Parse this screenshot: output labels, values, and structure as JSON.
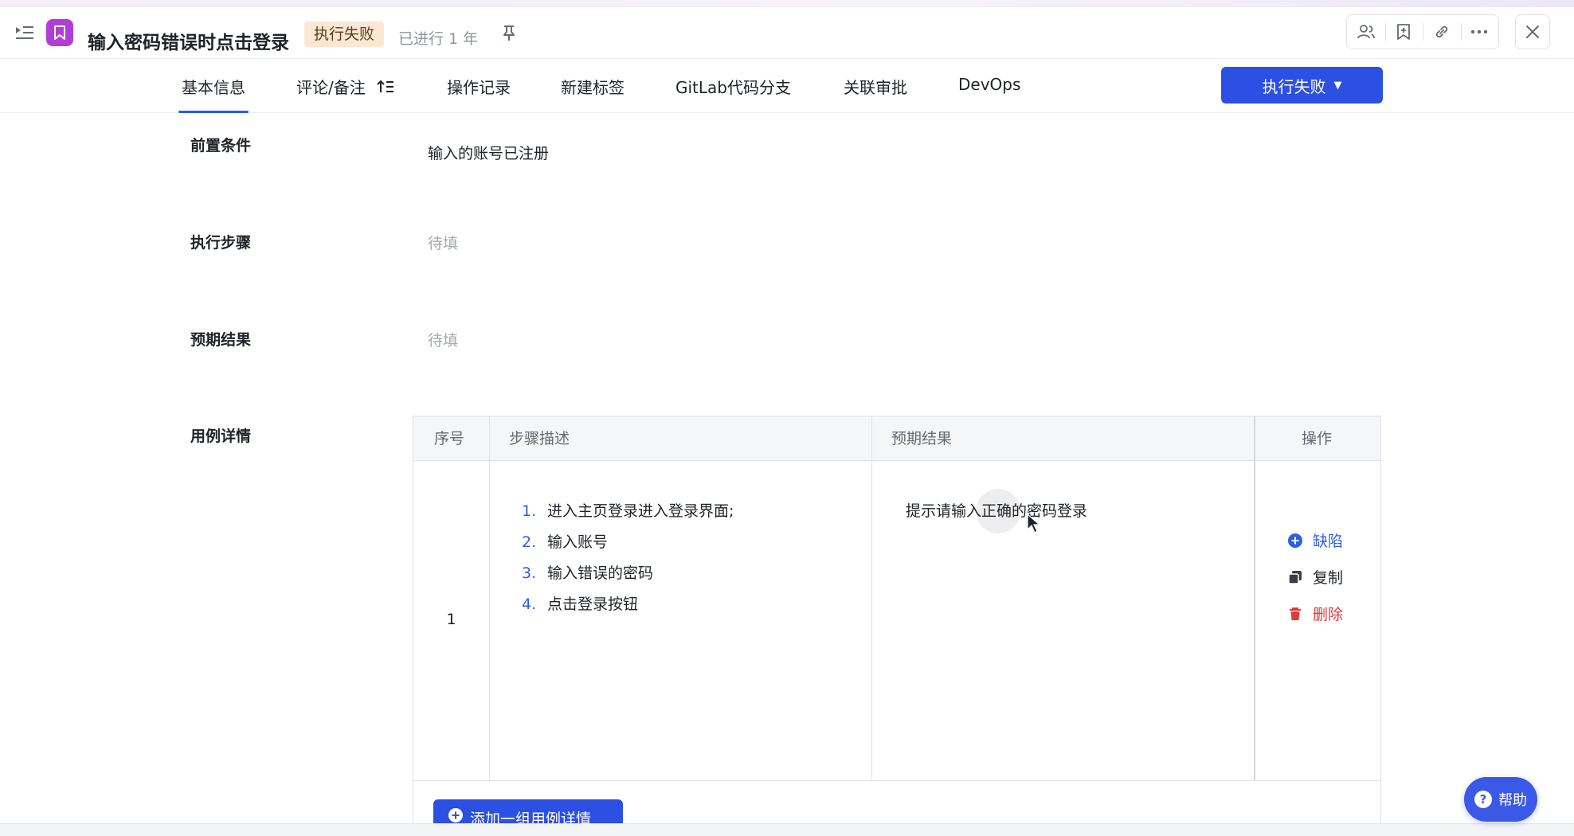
{
  "header": {
    "title": "输入密码错误时点击登录",
    "status_badge": "执行失败",
    "elapsed": "已进行 1 年",
    "icons": [
      "sidebar-toggle-icon",
      "bookmark-icon",
      "pin-icon",
      "members-icon",
      "add-bookmark-icon",
      "link-icon",
      "more-icon",
      "close-icon"
    ]
  },
  "tabs": [
    {
      "label": "基本信息",
      "active": true
    },
    {
      "label": "评论/备注",
      "active": false
    },
    {
      "label": "操作记录",
      "active": false
    },
    {
      "label": "新建标签",
      "active": false
    },
    {
      "label": "GitLab代码分支",
      "active": false
    },
    {
      "label": "关联审批",
      "active": false
    },
    {
      "label": "DevOps",
      "active": false
    }
  ],
  "status_button": {
    "label": "执行失败"
  },
  "fields": {
    "precondition": {
      "label": "前置条件",
      "value": "输入的账号已注册"
    },
    "steps": {
      "label": "执行步骤",
      "value": "待填"
    },
    "expected": {
      "label": "预期结果",
      "value": "待填"
    },
    "details": {
      "label": "用例详情"
    }
  },
  "table": {
    "headers": [
      "序号",
      "步骤描述",
      "预期结果",
      "操作"
    ],
    "rows": [
      {
        "seq": "1",
        "steps": [
          {
            "num": "1.",
            "text": "进入主页登录进入登录界面;"
          },
          {
            "num": "2.",
            "text": "输入账号"
          },
          {
            "num": "3.",
            "text": "输入错误的密码"
          },
          {
            "num": "4.",
            "text": "点击登录按钮"
          }
        ],
        "expected": "提示请输入正确的密码登录",
        "actions": [
          "缺陷",
          "复制",
          "删除"
        ]
      }
    ]
  },
  "add_button": {
    "label": "添加一组用例详情"
  },
  "help_button": {
    "label": "帮助"
  },
  "colors": {
    "accent": "#2c4fe4",
    "badge_bg": "#fde7d2",
    "app_icon": "#b43cd6",
    "delete": "#e03b3b"
  }
}
